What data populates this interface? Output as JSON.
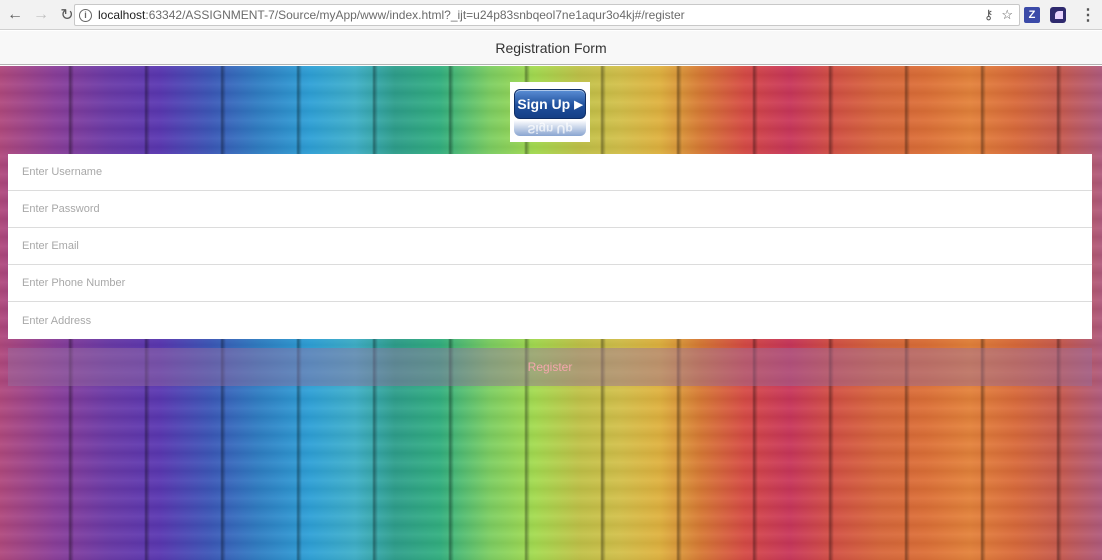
{
  "browser": {
    "url_host": "localhost",
    "url_path": ":63342/ASSIGNMENT-7/Source/myApp/www/index.html?_ijt=u24p83snbqeol7ne1aqur3o4kj#/register",
    "back_glyph": "←",
    "forward_glyph": "→",
    "reload_glyph": "↻",
    "info_glyph": "i",
    "key_glyph": "⚷",
    "star_glyph": "☆",
    "ext1_label": "Z",
    "menu_glyph": "⋮"
  },
  "header": {
    "title": "Registration Form"
  },
  "signup": {
    "label": "Sign Up",
    "arrow": "▶"
  },
  "form": {
    "username_placeholder": "Enter Username",
    "password_placeholder": "Enter Password",
    "email_placeholder": "Enter Email",
    "phone_placeholder": "Enter Phone Number",
    "address_placeholder": "Enter Address"
  },
  "register": {
    "label": "Register"
  },
  "colors": {
    "register_text": "#f4a7ad",
    "signup_blue": "#1f4f9c"
  }
}
